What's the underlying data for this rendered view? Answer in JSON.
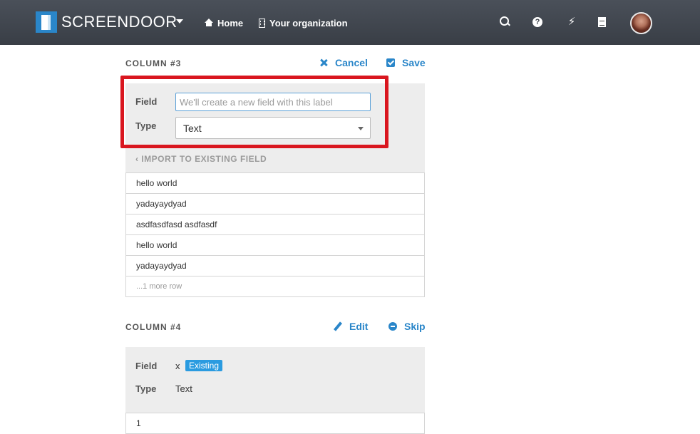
{
  "nav": {
    "brand": "SCREENDOOR",
    "home_label": "Home",
    "org_label": "Your organization",
    "help_glyph": "?",
    "bolt_glyph": "⚡"
  },
  "column3": {
    "title": "COLUMN #3",
    "cancel_label": "Cancel",
    "save_label": "Save",
    "field_label": "Field",
    "field_placeholder": "We'll create a new field with this label",
    "type_label": "Type",
    "type_value": "Text",
    "import_link": "‹ IMPORT TO EXISTING FIELD",
    "rows": [
      "hello world",
      "yadayaydyad",
      "asdfasdfasd asdfasdf",
      "hello world",
      "yadayaydyad"
    ],
    "more_rows": "...1 more row"
  },
  "column4": {
    "title": "COLUMN #4",
    "edit_label": "Edit",
    "skip_label": "Skip",
    "field_label": "Field",
    "field_value": "x",
    "badge": "Existing",
    "type_label": "Type",
    "type_value": "Text",
    "rows": [
      "1"
    ]
  },
  "colors": {
    "accent": "#2a86c9",
    "highlight": "#d9161f",
    "topbar": "#3e434b"
  }
}
